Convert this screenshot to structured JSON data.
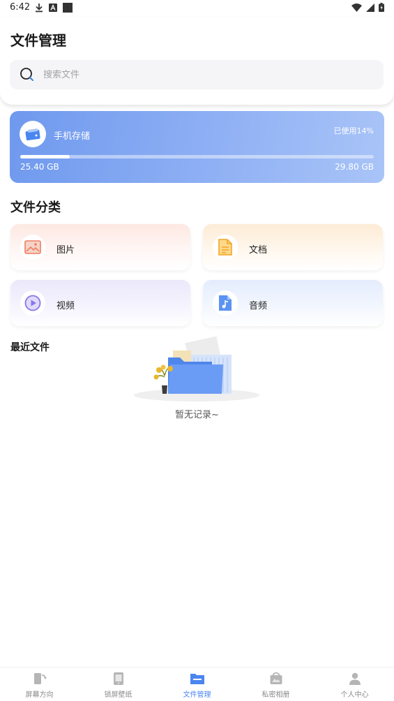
{
  "status_bar": {
    "time": "6:42",
    "left_icons": [
      "download-icon",
      "text-a-icon",
      "square-icon"
    ],
    "right_icons": [
      "wifi-icon",
      "signal-icon",
      "battery-icon"
    ]
  },
  "header": {
    "title": "文件管理",
    "search_placeholder": "搜索文件"
  },
  "storage": {
    "title": "手机存储",
    "used_label": "已使用14%",
    "used_fraction": 0.14,
    "used_size": "25.40 GB",
    "total_size": "29.80 GB"
  },
  "categories": {
    "title": "文件分类",
    "items": [
      {
        "label": "图片",
        "icon": "image-icon"
      },
      {
        "label": "文档",
        "icon": "document-icon"
      },
      {
        "label": "视频",
        "icon": "video-icon"
      },
      {
        "label": "音频",
        "icon": "audio-icon"
      }
    ]
  },
  "recent": {
    "title": "最近文件",
    "empty_text": "暂无记录~"
  },
  "bottom_nav": {
    "active_index": 2,
    "items": [
      {
        "label": "屏幕方向",
        "icon": "screen-orientation-icon"
      },
      {
        "label": "锁屏壁纸",
        "icon": "lock-wallpaper-icon"
      },
      {
        "label": "文件管理",
        "icon": "folder-icon"
      },
      {
        "label": "私密相册",
        "icon": "private-album-icon"
      },
      {
        "label": "个人中心",
        "icon": "person-icon"
      }
    ]
  },
  "colors": {
    "accent": "#4a86f0",
    "storage_gradient_start": "#6f99ee",
    "storage_gradient_end": "#a9c4f7",
    "nav_inactive": "#8a8a8a"
  }
}
